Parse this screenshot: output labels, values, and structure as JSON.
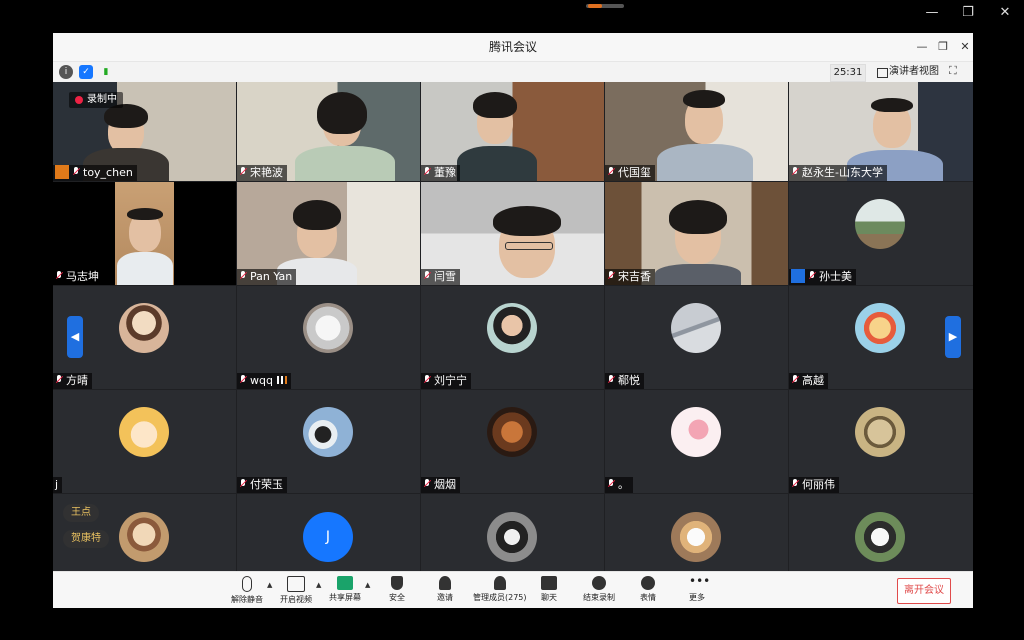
{
  "app": {
    "title": "腾讯会议",
    "timer": "25:31",
    "view_mode": "演讲者视图",
    "recording": "录制中",
    "leave_label": "离开会议"
  },
  "colors": {
    "accent": "#1677ff",
    "host": "#e07a1a",
    "danger": "#e04b4b",
    "grid_bg": "#1f2023"
  },
  "participants": [
    {
      "name": "toy_chen"
    },
    {
      "name": "宋艳波"
    },
    {
      "name": "董豫"
    },
    {
      "name": "代国玺"
    },
    {
      "name": "赵永生-山东大学"
    },
    {
      "name": "马志坤"
    },
    {
      "name": "Pan Yan"
    },
    {
      "name": "闫雪"
    },
    {
      "name": "宋吉香"
    },
    {
      "name": "孙士美"
    },
    {
      "name": "方晴"
    },
    {
      "name": "wqq"
    },
    {
      "name": "刘宁宁"
    },
    {
      "name": "郗悦"
    },
    {
      "name": "高越"
    },
    {
      "name": "j"
    },
    {
      "name": "付荣玉"
    },
    {
      "name": "烟烟"
    },
    {
      "name": "。"
    },
    {
      "name": "何丽伟"
    }
  ],
  "last_row": {
    "avatar_letter": "J",
    "reactions": [
      "王点",
      "贺康特"
    ]
  },
  "toolbar": {
    "unmute": "解除静音",
    "start_video": "开启视频",
    "share_screen": "共享屏幕",
    "security": "安全",
    "invite": "邀请",
    "manage_members": "管理成员(275)",
    "chat": "聊天",
    "stop_recording": "结束录制",
    "reactions": "表情",
    "more": "更多"
  }
}
